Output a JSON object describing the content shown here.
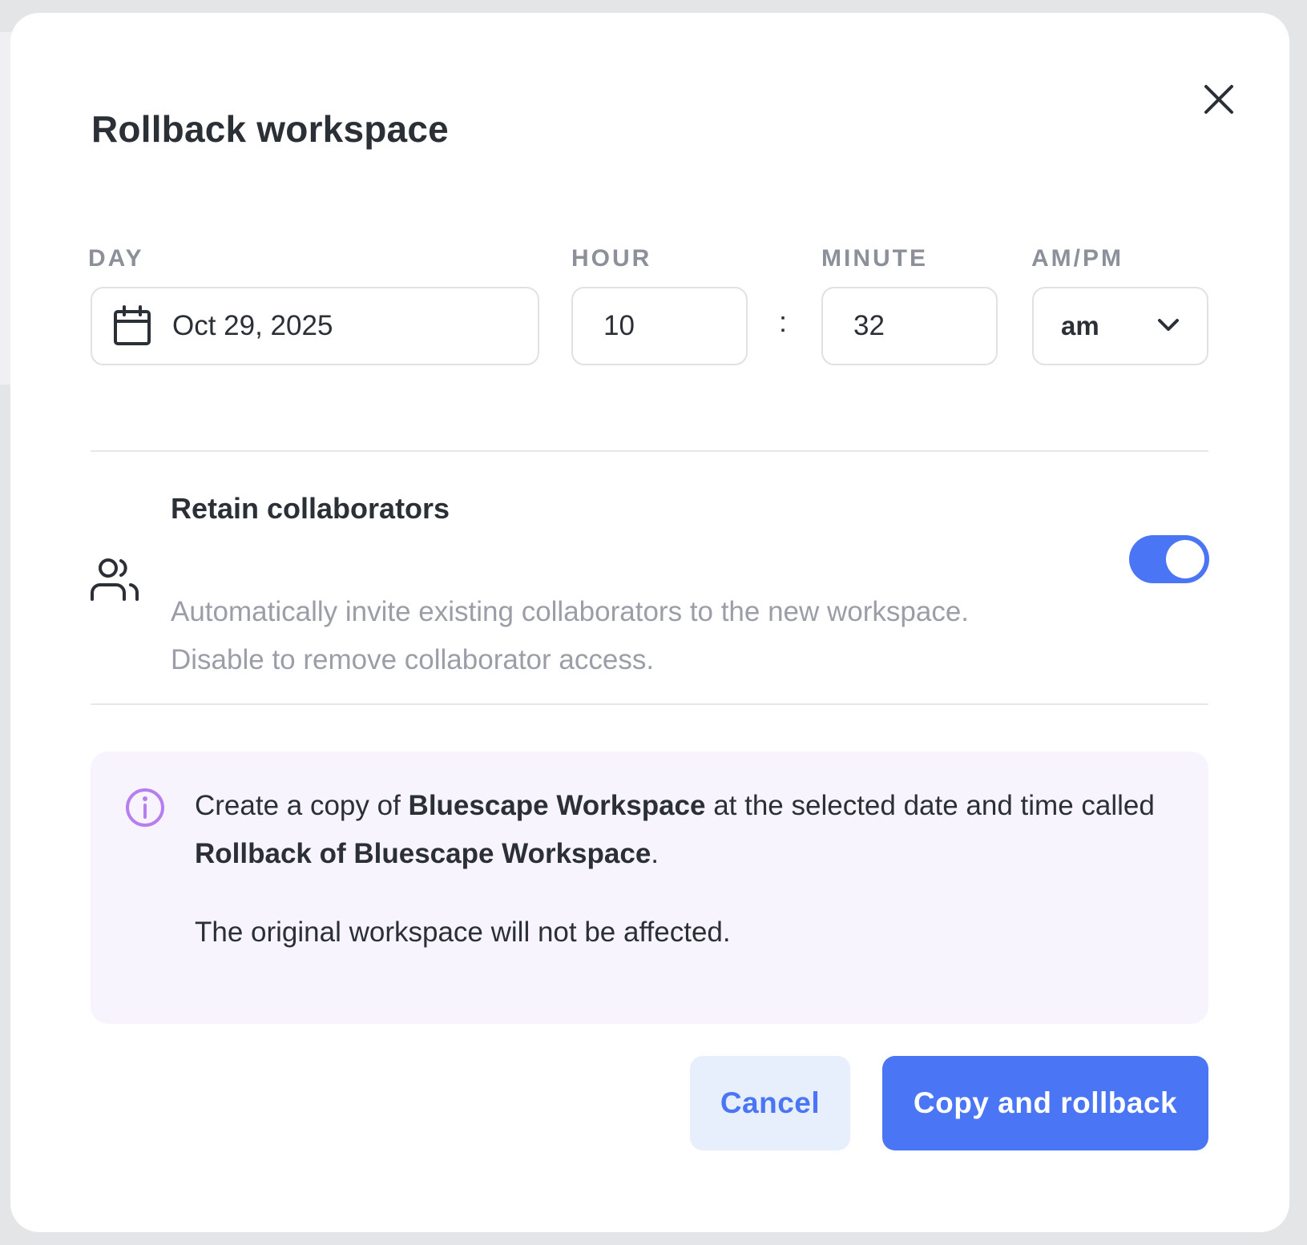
{
  "dialog": {
    "title": "Rollback workspace",
    "close_icon": "close-icon"
  },
  "datetime": {
    "labels": {
      "day": "DAY",
      "hour": "HOUR",
      "minute": "MINUTE",
      "ampm": "AM/PM"
    },
    "day_value": "Oct 29, 2025",
    "day_icon": "calendar-icon",
    "hour_value": "10",
    "separator": ":",
    "minute_value": "32",
    "ampm_value": "am",
    "ampm_icon": "chevron-down-icon"
  },
  "retain": {
    "icon": "users-icon",
    "title": "Retain collaborators",
    "description_line1": "Automatically invite existing collaborators to the new workspace.",
    "description_line2": "Disable to remove collaborator access.",
    "enabled": true
  },
  "info": {
    "icon": "info-icon",
    "text_prefix": "Create a copy of ",
    "workspace_name": "Bluescape Workspace",
    "text_middle": " at the selected date and time called ",
    "new_name": "Rollback of Bluescape Workspace",
    "text_suffix": ".",
    "note": "The original workspace will not be affected."
  },
  "actions": {
    "cancel_label": "Cancel",
    "confirm_label": "Copy and rollback"
  },
  "colors": {
    "accent": "#4a76f5",
    "info_bg": "#f7f4fe",
    "info_icon": "#b77ef0",
    "cancel_bg": "#e8effc"
  }
}
